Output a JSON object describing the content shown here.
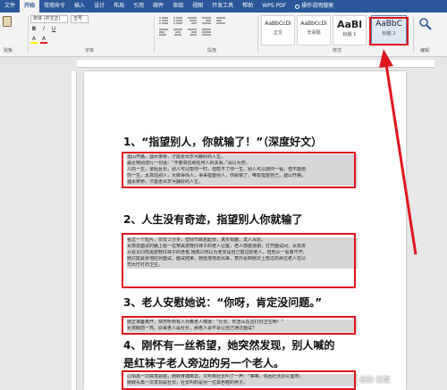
{
  "tabs": [
    "文件",
    "开始",
    "常用命令",
    "插入",
    "设计",
    "布局",
    "引用",
    "邮件",
    "审阅",
    "视图",
    "开发工具",
    "帮助",
    "WPS PDF",
    "操作说明搜索"
  ],
  "ribbon": {
    "clipboard_label": "贴板",
    "font_name": "宋体 (中文正)",
    "font_size": "五号",
    "group_font": "字体",
    "group_paragraph": "段落",
    "group_styles": "样式",
    "group_editing": "编辑",
    "styles": [
      {
        "sample": "AaBbCcDi",
        "name": "正文"
      },
      {
        "sample": "AaBbCcDi",
        "name": "无间隔"
      },
      {
        "sample": "AaBl",
        "name": "标题 1"
      },
      {
        "sample": "AaBbC",
        "name": "标题 2"
      }
    ],
    "editing_label": "编辑",
    "bold": "B",
    "italic": "I",
    "underline": "U",
    "font_color": "A",
    "highlight": "A"
  },
  "document": {
    "heading1": "1、“指望别人，你就输了！”（深度好文）",
    "para1": [
      "途山开路，遇水架桥，才能走出岁月静好的人生。",
      "最近特别流行一句话：“不要高估和任何人的关系。”深以为然。",
      "人的一生，道阻且长，别人可以帮你一时，但帮不了你一生。别人可以陪你一程，但不能陪",
      "你一生。太高估别人，大做事情人，事事指望别人，你就输了。唯有指望自己，遇山开路，",
      "遇水架桥，才能走出岁月静好的人生。"
    ],
    "heading2": "2、人生没有奇迹，指望别人你就输了",
    "para2": [
      "看过一个短片，仅仅２分多，但情节跌宕起伏，真实有趣，发人深思。",
      "女孩去面试的路上给一位穿黑皮鞋红袜子的老人让座，老人感激道谢，打开面试间，女孩发",
      "从看见同样黑皮鞋红袜子的老者,她真兴地以为老安是自己帮过的老人，但他从一看着不开，",
      "她只能紧张地应对面试。面试结束，她低落地走出来，意外看到她早上帮过的那位老人在公",
      "司大厅打扫卫生。"
    ],
    "heading3": "3、老人安慰她说：“你呀，肯定没问题。”",
    "para3": [
      "她正准备离开，突然听到有人对着老人喊道：“社长，你怎么在这打扫卫生啊！”",
      "女孩眼前一亮，原来老人是社长，那老人会不会让自己通过面试？"
    ],
    "heading4_line1": "4、刚怀有一丝希望，她突然发现，别人喊的",
    "heading4_line2": "是红袜子老人旁边的另一个老人。",
    "para4": [
      "心情再一次跌落谷底，她转身捷离去，又听到社长叫了一声：“等等，快回社长办公室吧。",
      "她转头再一次发现是社长，社长叫的是另一位黑色鞋的男子。"
    ]
  },
  "watermark": "经验·百度"
}
